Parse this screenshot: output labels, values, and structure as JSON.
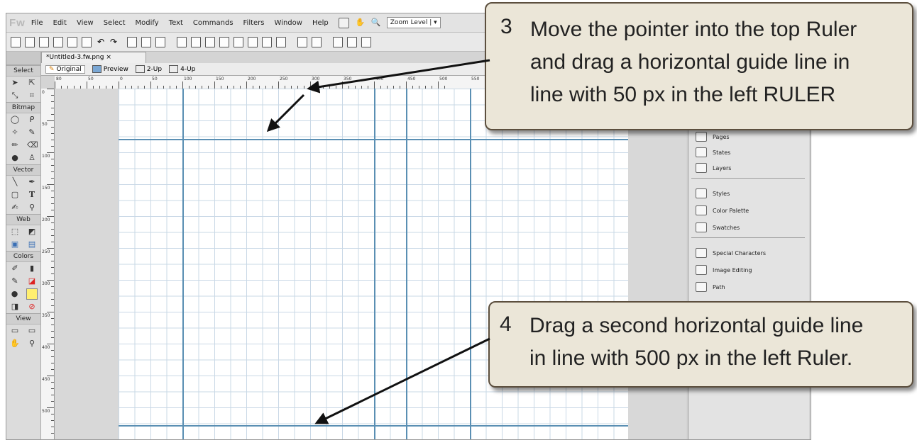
{
  "app": {
    "logo": "Fw",
    "menu": [
      "File",
      "Edit",
      "View",
      "Select",
      "Modify",
      "Text",
      "Commands",
      "Filters",
      "Window",
      "Help"
    ],
    "zoom_label": "Zoom Level | ▾"
  },
  "document_tab": {
    "label": "*Untitled-3.fw.png ×"
  },
  "view_modes": [
    {
      "label": "Original"
    },
    {
      "label": "Preview"
    },
    {
      "label": "2-Up"
    },
    {
      "label": "4-Up"
    }
  ],
  "tools_panel": {
    "sections": [
      {
        "title": "Select"
      },
      {
        "title": "Bitmap"
      },
      {
        "title": "Vector"
      },
      {
        "title": "Web"
      },
      {
        "title": "Colors"
      },
      {
        "title": "View"
      }
    ]
  },
  "ruler_top_labels": [
    "80",
    "50",
    "0",
    "50",
    "100",
    "150",
    "200",
    "250",
    "300",
    "350",
    "400",
    "450",
    "500",
    "550"
  ],
  "ruler_left_labels": [
    "0",
    "50",
    "100",
    "150",
    "200",
    "250",
    "300",
    "350",
    "400",
    "450",
    "500"
  ],
  "right_panel": {
    "items": [
      {
        "label": "Pages",
        "icon": "pages-icon"
      },
      {
        "label": "States",
        "icon": "states-icon"
      },
      {
        "label": "Layers",
        "icon": "layers-icon"
      },
      {
        "label": "Styles",
        "icon": "styles-icon"
      },
      {
        "label": "Color Palette",
        "icon": "color-palette-icon"
      },
      {
        "label": "Swatches",
        "icon": "swatches-icon"
      },
      {
        "label": "Special Characters",
        "icon": "special-characters-icon"
      },
      {
        "label": "Image Editing",
        "icon": "image-editing-icon"
      },
      {
        "label": "Path",
        "icon": "path-icon"
      }
    ]
  },
  "callouts": [
    {
      "number": "3",
      "text_lines": [
        "Move the pointer into the top Ruler",
        "and drag a horizontal guide line in",
        "line with 50 px in the left RULER"
      ]
    },
    {
      "number": "4",
      "text_lines": [
        "Drag a second horizontal guide line",
        "in line with 500 px in the left Ruler."
      ]
    }
  ],
  "colors": {
    "guide": "#5a8fb3",
    "grid": "#c9d8e6",
    "callout_bg": "#ebe6d8",
    "callout_border": "#5c4f3e"
  }
}
